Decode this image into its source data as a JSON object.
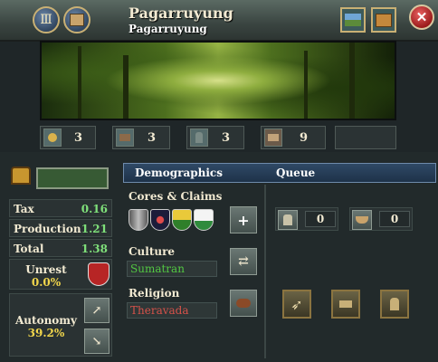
{
  "header": {
    "title": "Pagarruyung",
    "subtitle": "Pagarruyung"
  },
  "stats": [
    {
      "icon": "tax-icon",
      "value": "3"
    },
    {
      "icon": "production-icon",
      "value": "3"
    },
    {
      "icon": "manpower-icon",
      "value": "3"
    },
    {
      "icon": "trade-goods-icon",
      "value": "9"
    }
  ],
  "economy": {
    "tax_label": "Tax",
    "tax_value": "0.16",
    "production_label": "Production",
    "production_value": "1.21",
    "total_label": "Total",
    "total_value": "1.38"
  },
  "unrest": {
    "label": "Unrest",
    "value": "0.0%"
  },
  "autonomy": {
    "label": "Autonomy",
    "value": "39.2%"
  },
  "tabs": {
    "demographics": "Demographics",
    "queue": "Queue"
  },
  "demographics": {
    "cores_title": "Cores & Claims",
    "culture_title": "Culture",
    "culture_value": "Sumatran",
    "religion_title": "Religion",
    "religion_value": "Theravada"
  },
  "queue": {
    "army_count": "0",
    "navy_count": "0"
  },
  "colors": {
    "accent_gold": "#c9b074",
    "positive_green": "#7fe07a",
    "culture_green": "#52c842",
    "religion_red": "#d6524a",
    "highlight_yellow": "#f1d64c"
  }
}
